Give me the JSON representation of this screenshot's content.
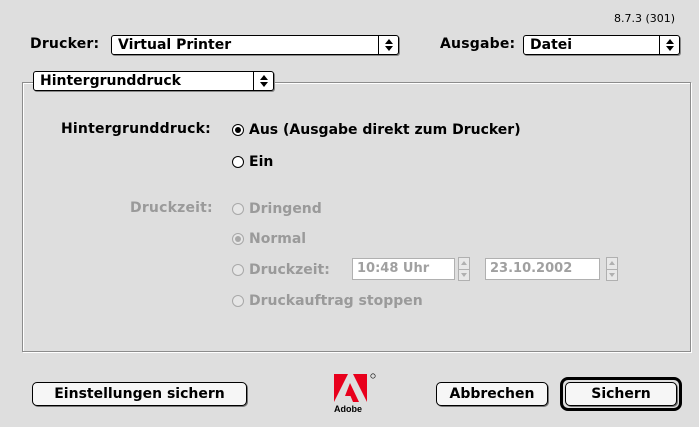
{
  "version": "8.7.3 (301)",
  "top": {
    "printer_label": "Drucker:",
    "printer_value": "Virtual Printer",
    "output_label": "Ausgabe:",
    "output_value": "Datei"
  },
  "panel_selector": {
    "value": "Hintergrunddruck"
  },
  "background": {
    "label": "Hintergrunddruck:",
    "options": [
      {
        "label": "Aus (Ausgabe direkt zum Drucker)",
        "selected": true
      },
      {
        "label": "Ein",
        "selected": false
      }
    ]
  },
  "print_time": {
    "label": "Druckzeit:",
    "options": [
      {
        "label": "Dringend",
        "selected": false
      },
      {
        "label": "Normal",
        "selected": true
      },
      {
        "label": "Druckzeit:",
        "selected": false
      },
      {
        "label": "Druckauftrag stoppen",
        "selected": false
      }
    ],
    "time_value": "10:48 Uhr",
    "date_value": "23.10.2002"
  },
  "buttons": {
    "save_settings": "Einstellungen sichern",
    "cancel": "Abbrechen",
    "save": "Sichern"
  },
  "logo": {
    "text": "Adobe",
    "icon": "adobe-logo-icon",
    "color": "#e8001c"
  }
}
